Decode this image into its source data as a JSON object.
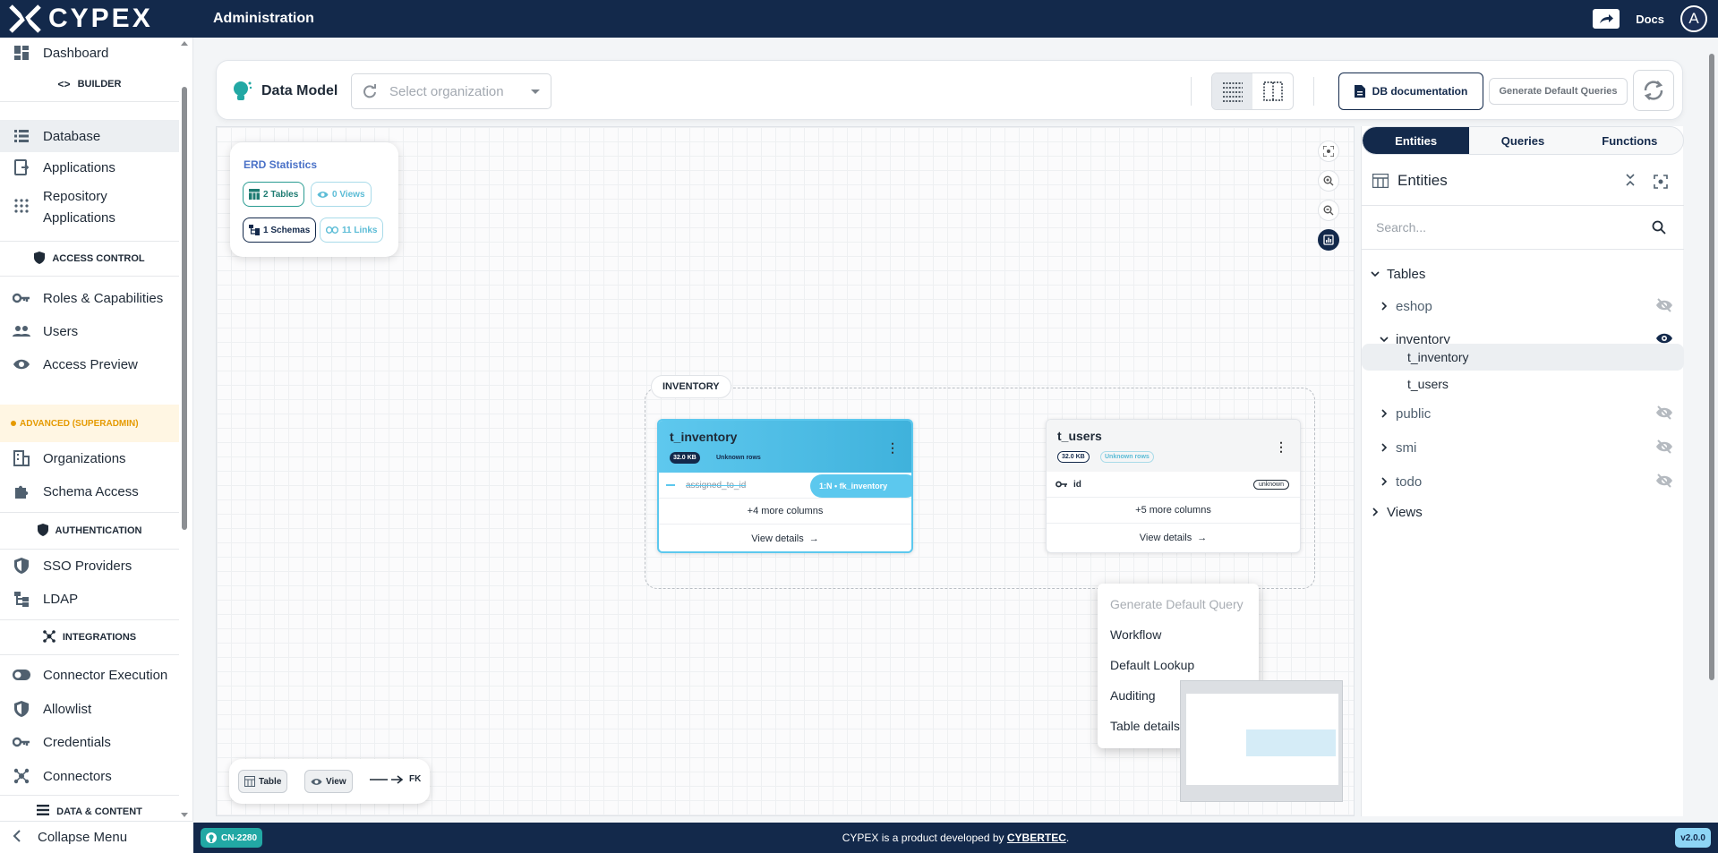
{
  "app": {
    "logo_text": "CYPEX",
    "page_title": "Administration",
    "docs_label": "Docs",
    "avatar_letter": "A"
  },
  "sidebar": {
    "items": [
      {
        "label": "Dashboard",
        "icon": "dashboard-icon"
      },
      {
        "label": "Database",
        "icon": "database-icon",
        "active": true
      },
      {
        "label": "Applications",
        "icon": "applications-icon"
      },
      {
        "label": "Repository Applications",
        "icon": "apps-grid-icon"
      },
      {
        "label": "Roles & Capabilities",
        "icon": "key-icon"
      },
      {
        "label": "Users",
        "icon": "users-icon"
      },
      {
        "label": "Access Preview",
        "icon": "eye-icon"
      },
      {
        "label": "Organizations",
        "icon": "building-icon"
      },
      {
        "label": "Schema Access",
        "icon": "puzzle-icon"
      },
      {
        "label": "SSO Providers",
        "icon": "shield-icon"
      },
      {
        "label": "LDAP",
        "icon": "ldap-icon"
      },
      {
        "label": "Connector Execution",
        "icon": "toggle-icon"
      },
      {
        "label": "Allowlist",
        "icon": "shield-check-icon"
      },
      {
        "label": "Credentials",
        "icon": "key-icon"
      },
      {
        "label": "Connectors",
        "icon": "hub-icon"
      }
    ],
    "sections": {
      "builder": "BUILDER",
      "access_control": "ACCESS CONTROL",
      "advanced": "ADVANCED (SUPERADMIN)",
      "authentication": "AUTHENTICATION",
      "integrations": "INTEGRATIONS",
      "data_content": "DATA & CONTENT"
    },
    "collapse_label": "Collapse Menu"
  },
  "toolbar": {
    "title": "Data Model",
    "org_placeholder": "Select organization",
    "db_doc_label": "DB documentation",
    "gen_queries_label": "Generate Default Queries"
  },
  "erd_stats": {
    "title": "ERD Statistics",
    "tables": "2 Tables",
    "views": "0 Views",
    "schemas": "1 Schemas",
    "links": "11 Links"
  },
  "group": {
    "label": "INVENTORY"
  },
  "tables": {
    "inventory": {
      "name": "t_inventory",
      "size": "32.0 KB",
      "rows": "Unknown rows",
      "column": "assigned_to_id",
      "fk": "1:N • fk_inventory",
      "more": "+4 more columns",
      "view": "View details"
    },
    "users": {
      "name": "t_users",
      "size": "32.0 KB",
      "rows": "Unknown rows",
      "column": "id",
      "column_type": "unknown",
      "more": "+5 more columns",
      "view": "View details"
    }
  },
  "context_menu": {
    "items": [
      "Generate Default Query",
      "Workflow",
      "Default Lookup",
      "Auditing",
      "Table details"
    ]
  },
  "legend": {
    "table": "Table",
    "view": "View",
    "fk": "FK"
  },
  "right_panel": {
    "tabs": [
      "Entities",
      "Queries",
      "Functions"
    ],
    "active_tab": "Entities",
    "heading": "Entities",
    "search_placeholder": "Search...",
    "tree": {
      "tables_label": "Tables",
      "schemas": [
        {
          "name": "eshop",
          "visible": false
        },
        {
          "name": "inventory",
          "visible": true,
          "children": [
            "t_inventory",
            "t_users"
          ]
        },
        {
          "name": "public",
          "visible": false
        },
        {
          "name": "smi",
          "visible": false
        },
        {
          "name": "todo",
          "visible": false
        }
      ],
      "views_label": "Views"
    }
  },
  "footer": {
    "badge": "CN-2280",
    "text_before": "CYPEX is a product developed by",
    "company": "CYBERTEC",
    "text_after": ".",
    "version": "v2.0.0"
  },
  "colors": {
    "navy": "#13294b",
    "accent_blue": "#5cc8ee",
    "teal": "#22a8a4",
    "warning": "#e59a00"
  }
}
